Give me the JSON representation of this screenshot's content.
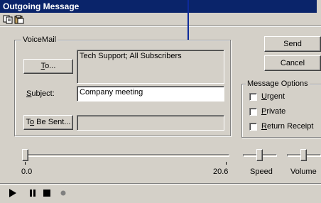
{
  "window": {
    "title": "Outgoing Message"
  },
  "toolbar": {
    "icons": [
      "copy-icon",
      "paste-icon"
    ]
  },
  "voicemail": {
    "group_label": "VoiceMail",
    "to_label": "To...",
    "to_value": "Tech Support; All Subscribers",
    "subject_label": "Subject:",
    "subject_value": "Company meeting",
    "tobesent_label": "To Be Sent...",
    "tobesent_value": ""
  },
  "actions": {
    "send_label": "Send",
    "cancel_label": "Cancel"
  },
  "options": {
    "group_label": "Message Options",
    "urgent": {
      "label": "Urgent",
      "checked": false
    },
    "private": {
      "label": "Private",
      "checked": false
    },
    "return_receipt": {
      "label": "Return Receipt",
      "checked": false
    }
  },
  "position": {
    "start": "0.0",
    "end": "20.6"
  },
  "speed_label": "Speed",
  "volume_label": "Volume",
  "playback": {
    "icons": [
      "play-icon",
      "pause-icon",
      "stop-icon",
      "record-icon"
    ]
  },
  "colors": {
    "titlebar": "#0a246a",
    "face": "#d4d0c8",
    "record": "#808080"
  }
}
